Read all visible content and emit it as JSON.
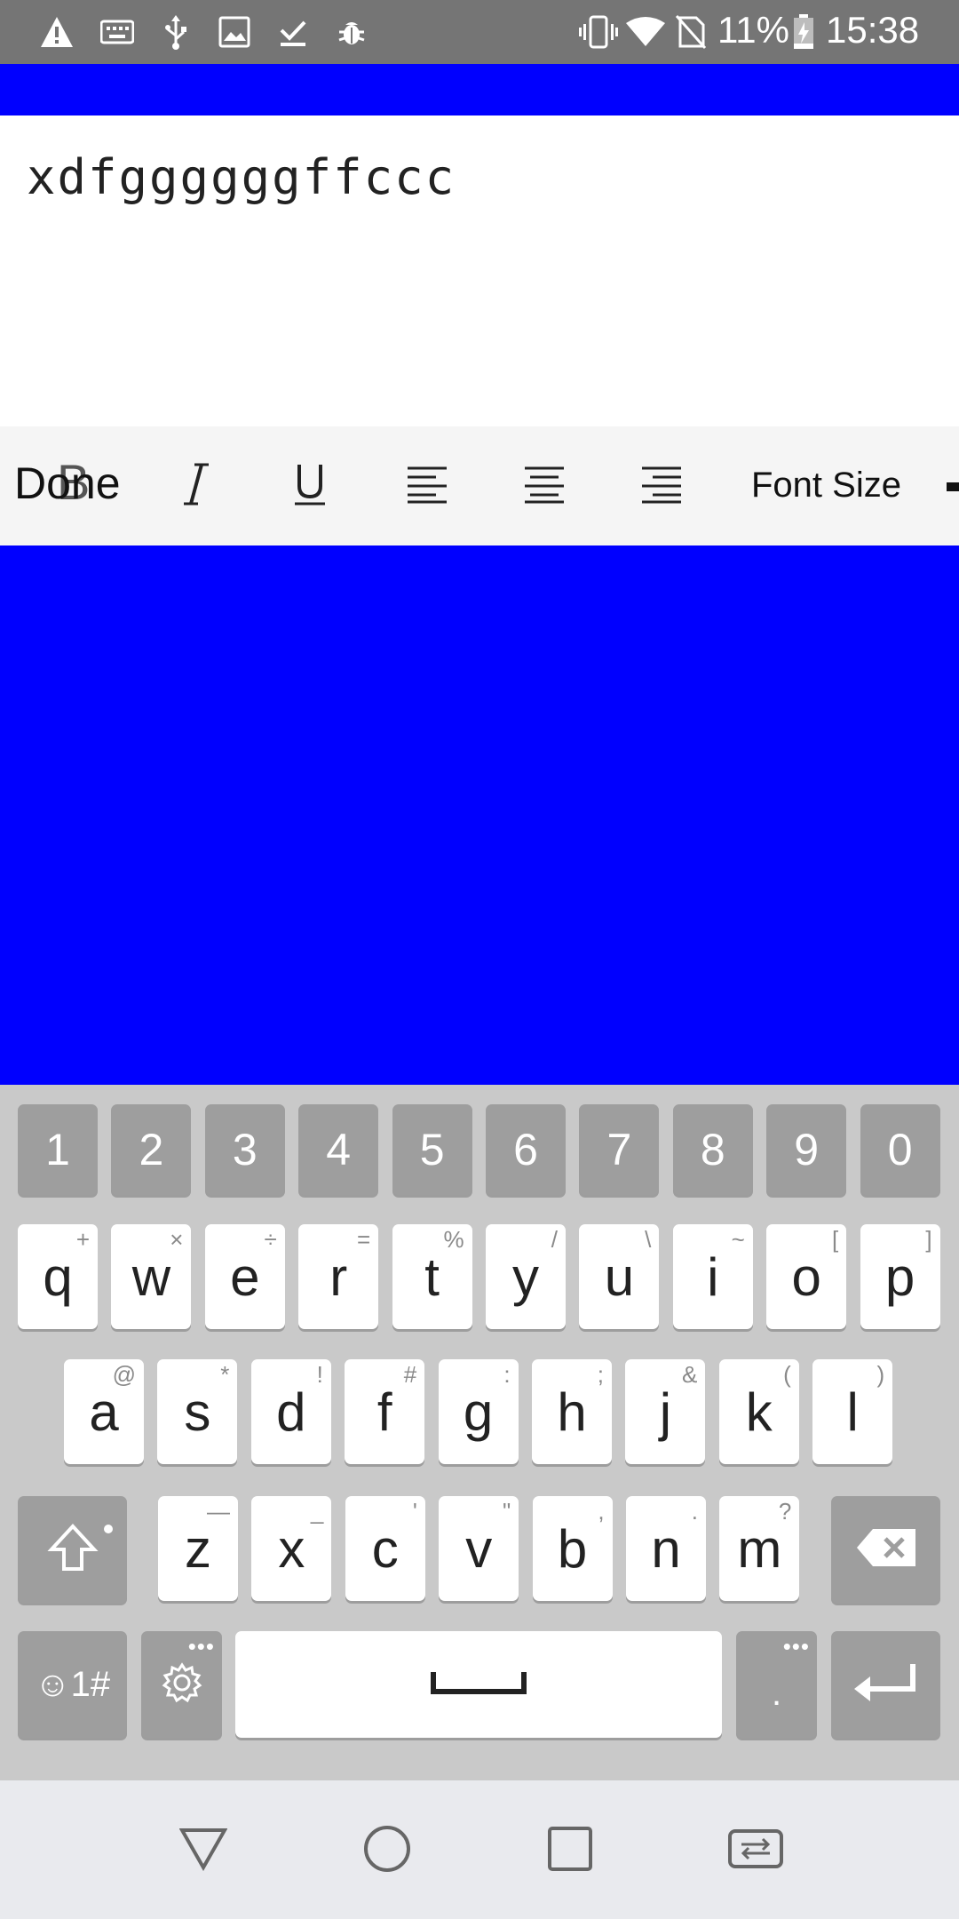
{
  "status_bar": {
    "battery_percent": "11%",
    "time": "15:38",
    "left_icons": [
      "warning-icon",
      "keyboard-icon",
      "usb-icon",
      "image-icon",
      "download-done-icon",
      "bug-icon"
    ],
    "right_icons": [
      "vibrate-icon",
      "wifi-icon",
      "no-sim-icon",
      "battery-charging-icon"
    ]
  },
  "colors": {
    "accent_blue": "#0000ff",
    "status_bar": "#757575",
    "toolbar": "#f5f5f5",
    "keyboard_bg": "#c9c9c9",
    "key_dark": "#9e9e9e",
    "key_light": "#ffffff",
    "nav_bar": "#e9eaee"
  },
  "editor": {
    "text": "xdfggggggffccc"
  },
  "toolbar": {
    "done_label": "Done",
    "bold_label": "B",
    "italic_label": "I",
    "underline_label": "U",
    "font_size_label": "Font Size",
    "icons": [
      "italic-icon",
      "underline-icon",
      "align-left-icon",
      "align-center-icon",
      "align-right-icon"
    ]
  },
  "keyboard": {
    "number_row": [
      "1",
      "2",
      "3",
      "4",
      "5",
      "6",
      "7",
      "8",
      "9",
      "0"
    ],
    "row1": [
      {
        "k": "q",
        "h": "+"
      },
      {
        "k": "w",
        "h": "×"
      },
      {
        "k": "e",
        "h": "÷"
      },
      {
        "k": "r",
        "h": "="
      },
      {
        "k": "t",
        "h": "%"
      },
      {
        "k": "y",
        "h": "/"
      },
      {
        "k": "u",
        "h": "\\"
      },
      {
        "k": "i",
        "h": "~"
      },
      {
        "k": "o",
        "h": "["
      },
      {
        "k": "p",
        "h": "]"
      }
    ],
    "row2": [
      {
        "k": "a",
        "h": "@"
      },
      {
        "k": "s",
        "h": "*"
      },
      {
        "k": "d",
        "h": "!"
      },
      {
        "k": "f",
        "h": "#"
      },
      {
        "k": "g",
        "h": ":"
      },
      {
        "k": "h",
        "h": ";"
      },
      {
        "k": "j",
        "h": "&"
      },
      {
        "k": "k",
        "h": "("
      },
      {
        "k": "l",
        "h": ")"
      }
    ],
    "row3": [
      {
        "k": "z",
        "h": "—"
      },
      {
        "k": "x",
        "h": "_"
      },
      {
        "k": "c",
        "h": "'"
      },
      {
        "k": "v",
        "h": "\""
      },
      {
        "k": "b",
        "h": ","
      },
      {
        "k": "n",
        "h": "."
      },
      {
        "k": "m",
        "h": "?"
      }
    ],
    "symbols_label": "☺1#",
    "period_label": "."
  },
  "nav_bar": {
    "icons": [
      "back-icon",
      "home-icon",
      "recents-icon",
      "rotate-icon"
    ]
  }
}
